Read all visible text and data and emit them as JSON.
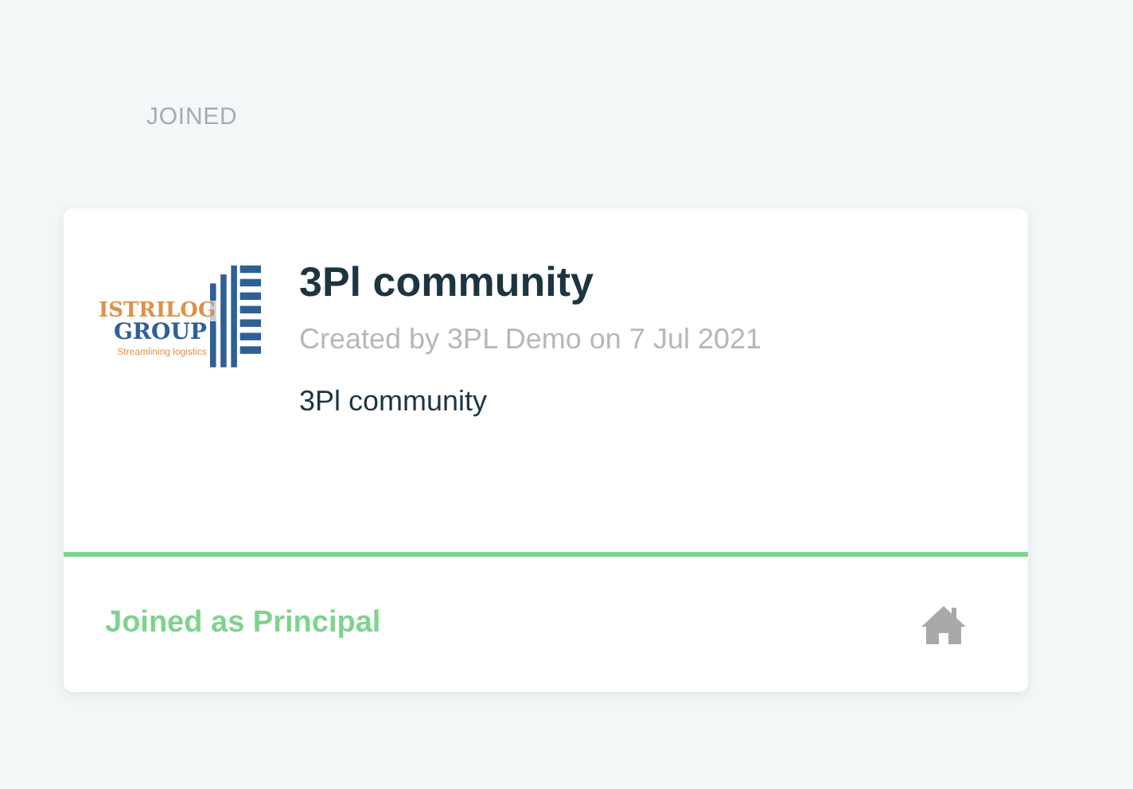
{
  "section_heading": "JOINED",
  "community": {
    "logo": {
      "line_1": "ISTRILOG",
      "line_2": "GROUP",
      "tagline": "Streamlining logistics"
    },
    "title": "3Pl community",
    "meta": "Created by 3PL Demo on 7 Jul 2021",
    "description": "3Pl community",
    "membership": "Joined as Principal"
  }
}
